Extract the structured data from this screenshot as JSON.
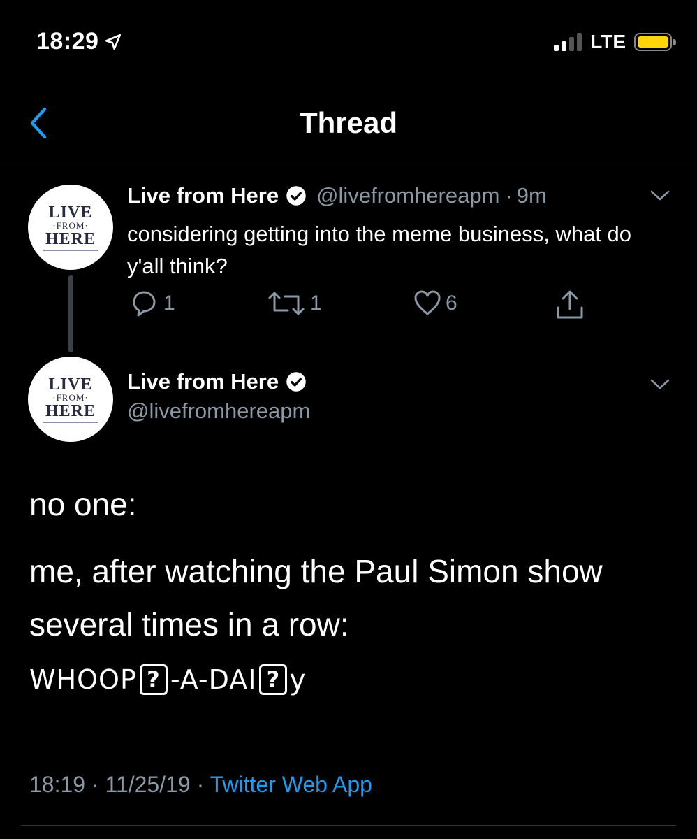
{
  "status_bar": {
    "time": "18:29",
    "network": "LTE",
    "battery_color": "#ffd60a",
    "icons": [
      "location-arrow-icon",
      "signal-icon",
      "battery-icon"
    ]
  },
  "nav": {
    "title": "Thread",
    "back_icon": "chevron-left-icon"
  },
  "tweets": [
    {
      "avatar": {
        "line1": "LIVE",
        "line2": "·FROM·",
        "line3": "HERE"
      },
      "name": "Live from Here",
      "handle": "@livefromhereapm",
      "separator": "·",
      "time_ago": "9m",
      "text": "considering getting into the meme business, what do y'all think?",
      "replies": "1",
      "retweets": "1",
      "likes": "6"
    }
  ],
  "main_tweet": {
    "avatar": {
      "line1": "LIVE",
      "line2": "·FROM·",
      "line3": "HERE"
    },
    "name": "Live from Here",
    "handle": "@livefromhereapm",
    "line1": "no one:",
    "line2": "me, after watching the Paul Simon show",
    "line3": "several times in a row:",
    "whoop_part1": "WHOOP",
    "unknown_glyph": "?",
    "whoop_part2": "-A-DAI",
    "whoop_part3": "y",
    "timestamp": "18:19 · 11/25/19 ·",
    "source": "Twitter Web App"
  },
  "colors": {
    "background": "#000000",
    "secondary_text": "#8b98a5",
    "link": "#1d9bf0",
    "back_chevron": "#1d9bf0",
    "divider": "#2f3336"
  }
}
